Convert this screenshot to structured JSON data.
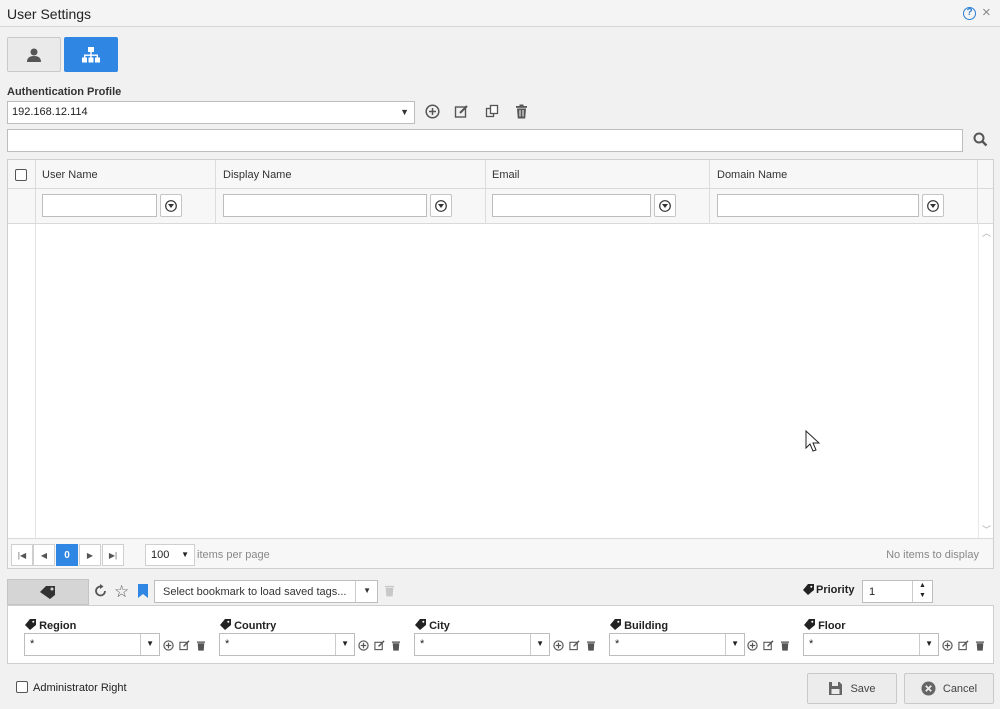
{
  "window": {
    "title": "User Settings"
  },
  "modes": [
    {
      "name": "user",
      "icon": "user-icon",
      "active": false
    },
    {
      "name": "hierarchy",
      "icon": "hierarchy-icon",
      "active": true
    }
  ],
  "auth": {
    "label": "Authentication Profile",
    "selected": "192.168.12.114"
  },
  "grid": {
    "columns": [
      "User Name",
      "Display Name",
      "Email",
      "Domain Name"
    ],
    "pager": {
      "current_page": "0",
      "page_size": "100",
      "items_per_page_label": "items per page",
      "empty_text": "No items to display"
    }
  },
  "tags": {
    "bookmark_placeholder": "Select bookmark to load saved tags...",
    "priority_label": "Priority",
    "priority_value": "1",
    "fields": [
      {
        "label": "Region",
        "value": "*"
      },
      {
        "label": "Country",
        "value": "*"
      },
      {
        "label": "City",
        "value": "*"
      },
      {
        "label": "Building",
        "value": "*"
      },
      {
        "label": "Floor",
        "value": "*"
      }
    ]
  },
  "footer": {
    "admin_label": "Administrator Right",
    "save_label": "Save",
    "cancel_label": "Cancel"
  },
  "colors": {
    "accent": "#2f86e3"
  }
}
